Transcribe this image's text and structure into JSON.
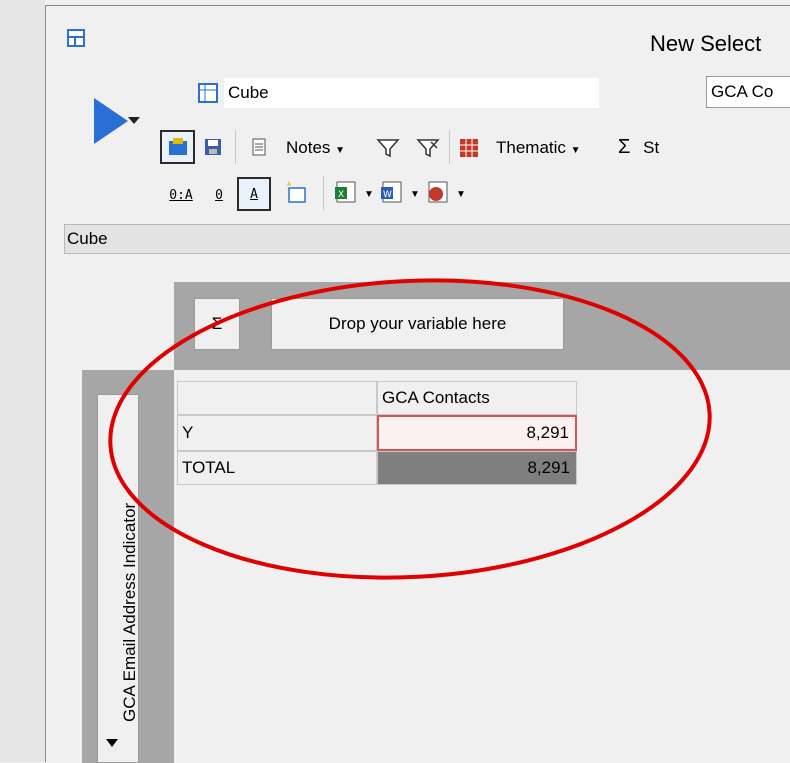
{
  "window": {
    "title": "New Select"
  },
  "toolbar": {
    "view_name": "Cube",
    "selection_box": "GCA Co",
    "notes_label": "Notes",
    "thematic_label": "Thematic",
    "stats_label": "St",
    "sigma": "Σ",
    "btn_0a": "0:A",
    "btn_0": "0",
    "btn_a": "A"
  },
  "pane": {
    "caption": "Cube"
  },
  "cube": {
    "sigma_button": "Σ",
    "drop_zone": "Drop your variable here",
    "row_axis_label": "GCA Email Address Indicator",
    "column_header": "GCA Contacts",
    "rows": [
      {
        "label": "Y",
        "value": "8,291"
      },
      {
        "label": "TOTAL",
        "value": "8,291"
      }
    ]
  },
  "colors": {
    "annotation": "#e00000",
    "play": "#2a6fd6",
    "total_cell": "#7f7f7f"
  }
}
